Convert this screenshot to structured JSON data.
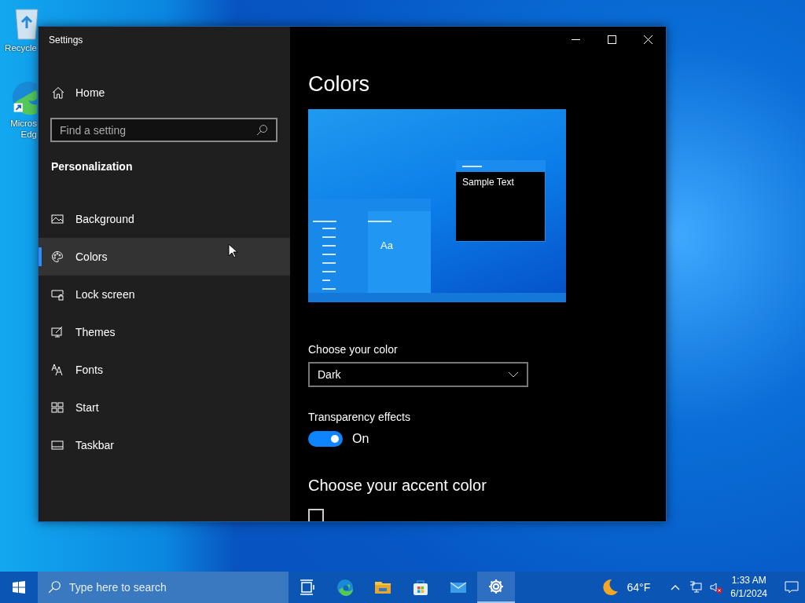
{
  "desktop": {
    "icons": [
      {
        "kind": "recycle",
        "lines": [
          "Recycle"
        ]
      },
      {
        "kind": "edge",
        "lines": [
          "Micros",
          "Edg"
        ]
      }
    ]
  },
  "window": {
    "title": "Settings",
    "sidebar": {
      "home": "Home",
      "search": {
        "placeholder": "Find a setting"
      },
      "section": "Personalization",
      "items": [
        {
          "kind": "background",
          "label": "Background",
          "selected": false
        },
        {
          "kind": "colors",
          "label": "Colors",
          "selected": true
        },
        {
          "kind": "lock",
          "label": "Lock screen",
          "selected": false
        },
        {
          "kind": "themes",
          "label": "Themes",
          "selected": false
        },
        {
          "kind": "fonts",
          "label": "Fonts",
          "selected": false
        },
        {
          "kind": "start",
          "label": "Start",
          "selected": false
        },
        {
          "kind": "taskbar",
          "label": "Taskbar",
          "selected": false
        }
      ]
    },
    "content": {
      "title": "Colors",
      "preview": {
        "sample_text": "Sample Text",
        "tile_text": "Aa"
      },
      "color_mode": {
        "label": "Choose your color",
        "value": "Dark"
      },
      "transparency": {
        "label": "Transparency effects",
        "on": true,
        "state_text": "On"
      },
      "accent_heading": "Choose your accent color",
      "auto_accent": {
        "checked": false
      }
    }
  },
  "taskbar": {
    "search": {
      "placeholder": "Type here to search"
    },
    "apps": [
      {
        "kind": "taskview",
        "selected": false
      },
      {
        "kind": "edge",
        "selected": false
      },
      {
        "kind": "explorer",
        "selected": false
      },
      {
        "kind": "store",
        "selected": false
      },
      {
        "kind": "mail",
        "selected": false
      },
      {
        "kind": "settings",
        "selected": true
      }
    ],
    "weather": "64°F",
    "time": "1:33 AM",
    "date": "6/1/2024"
  }
}
